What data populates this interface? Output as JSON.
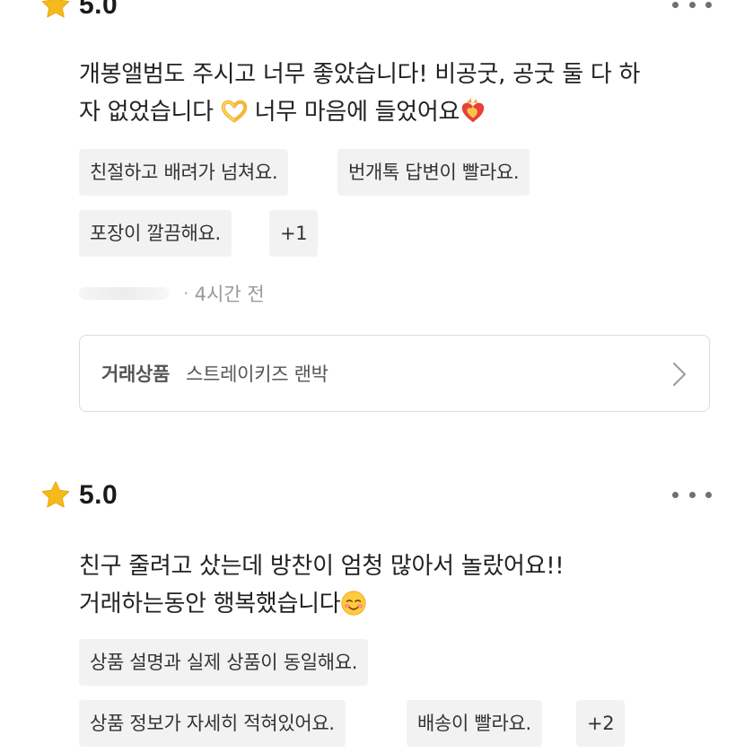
{
  "reviews": [
    {
      "rating": "5.0",
      "star_icon": "star-icon",
      "more_icon": "more-dots-icon",
      "text_line1": "개봉앨범도 주시고 너무 좋았습니다! 비공굿, 공굿 둘 다 하",
      "text_line2_a": "자 없었습니다 ",
      "text_line2_b": " 너무 마음에 들었어요",
      "emojis": [
        "heart-hands-emoji",
        "heart-on-fire-emoji"
      ],
      "tags": [
        "친절하고 배려가 넘쳐요.",
        "번개톡 답변이 빨라요.",
        "포장이 깔끔해요.",
        "+1"
      ],
      "time": "4시간 전",
      "product": {
        "label": "거래상품",
        "name": "스트레이키즈 랜박"
      }
    },
    {
      "rating": "5.0",
      "star_icon": "star-icon",
      "more_icon": "more-dots-icon",
      "text_line1": "친구 줄려고 샀는데 방찬이 엄청 많아서 놀랐어요!!",
      "text_line2": "거래하는동안 행복했습니다",
      "emojis": [
        "smiling-face-emoji"
      ],
      "tags": [
        "상품 설명과 실제 상품이 동일해요.",
        "상품 정보가 자세히 적혀있어요.",
        "배송이 빨라요.",
        "+2"
      ]
    }
  ],
  "colors": {
    "star": "#F5B91B",
    "tag_bg": "#F2F2F2",
    "card_border": "#DCDCDC",
    "muted_text": "#9A9A9A"
  }
}
